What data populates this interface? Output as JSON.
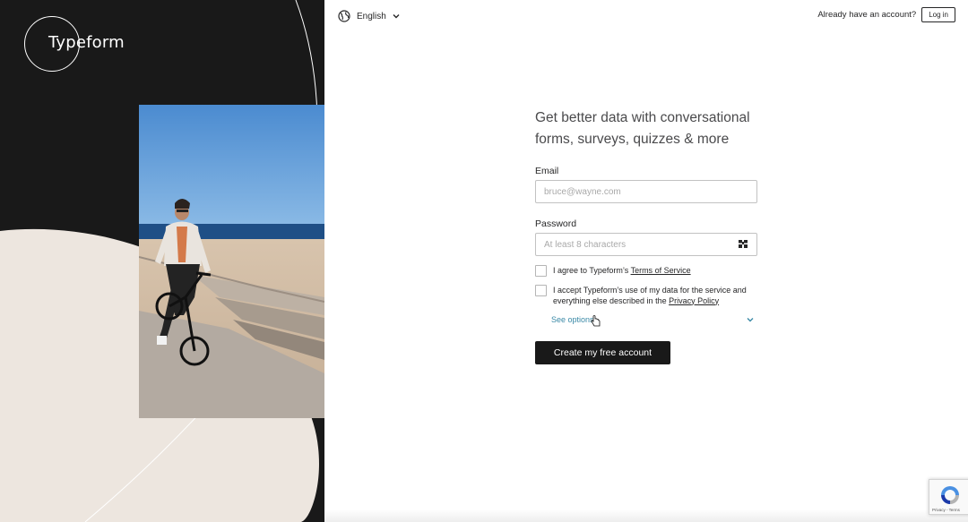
{
  "brand": {
    "logo_text": "Typeform"
  },
  "header": {
    "language": "English",
    "account_prompt": "Already have an account?",
    "login_label": "Log in"
  },
  "form": {
    "headline": "Get better data with conversational forms, surveys, quizzes & more",
    "email_label": "Email",
    "email_placeholder": "bruce@wayne.com",
    "password_label": "Password",
    "password_placeholder": "At least 8 characters",
    "terms_text": "I agree to Typeform’s ",
    "terms_link": "Terms of Service",
    "privacy_text": "I accept Typeform’s use of my data for the service and everything else described in the ",
    "privacy_link": "Privacy Policy",
    "see_options": "See options",
    "submit_label": "Create my free account"
  },
  "recaptcha": {
    "text": "Privacy - Terms"
  },
  "colors": {
    "left_panel": "#191919",
    "cream": "#ede6df",
    "link_blue": "#3b8aa7",
    "button_dark": "#191919"
  }
}
